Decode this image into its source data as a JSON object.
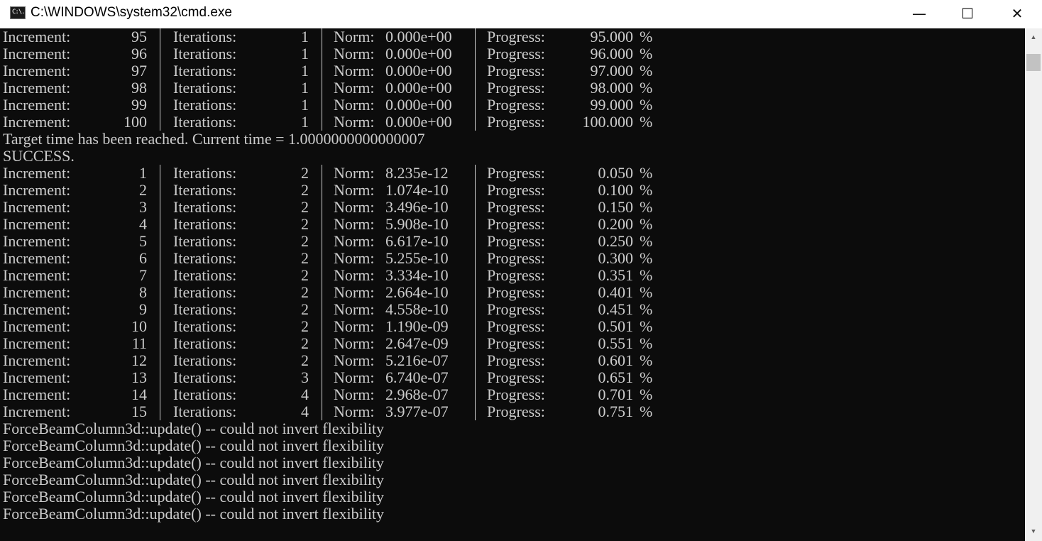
{
  "window": {
    "title": "C:\\WINDOWS\\system32\\cmd.exe",
    "icon_text": "C:\\.",
    "minimize": "—",
    "maximize": "☐",
    "close": "✕"
  },
  "labels": {
    "increment": "Increment:",
    "iterations": "Iterations:",
    "norm": "Norm:",
    "progress": "Progress:",
    "percent": "%"
  },
  "console": {
    "rows_a": [
      {
        "inc": "95",
        "iter": "1",
        "norm": "0.000e+00",
        "prog": "95.000"
      },
      {
        "inc": "96",
        "iter": "1",
        "norm": "0.000e+00",
        "prog": "96.000"
      },
      {
        "inc": "97",
        "iter": "1",
        "norm": "0.000e+00",
        "prog": "97.000"
      },
      {
        "inc": "98",
        "iter": "1",
        "norm": "0.000e+00",
        "prog": "98.000"
      },
      {
        "inc": "99",
        "iter": "1",
        "norm": "0.000e+00",
        "prog": "99.000"
      },
      {
        "inc": "100",
        "iter": "1",
        "norm": "0.000e+00",
        "prog": "100.000"
      }
    ],
    "target_msg": "Target time has been reached. Current time = 1.0000000000000007",
    "success_msg": "SUCCESS.",
    "rows_b": [
      {
        "inc": "1",
        "iter": "2",
        "norm": "8.235e-12",
        "prog": "0.050"
      },
      {
        "inc": "2",
        "iter": "2",
        "norm": "1.074e-10",
        "prog": "0.100"
      },
      {
        "inc": "3",
        "iter": "2",
        "norm": "3.496e-10",
        "prog": "0.150"
      },
      {
        "inc": "4",
        "iter": "2",
        "norm": "5.908e-10",
        "prog": "0.200"
      },
      {
        "inc": "5",
        "iter": "2",
        "norm": "6.617e-10",
        "prog": "0.250"
      },
      {
        "inc": "6",
        "iter": "2",
        "norm": "5.255e-10",
        "prog": "0.300"
      },
      {
        "inc": "7",
        "iter": "2",
        "norm": "3.334e-10",
        "prog": "0.351"
      },
      {
        "inc": "8",
        "iter": "2",
        "norm": "2.664e-10",
        "prog": "0.401"
      },
      {
        "inc": "9",
        "iter": "2",
        "norm": "4.558e-10",
        "prog": "0.451"
      },
      {
        "inc": "10",
        "iter": "2",
        "norm": "1.190e-09",
        "prog": "0.501"
      },
      {
        "inc": "11",
        "iter": "2",
        "norm": "2.647e-09",
        "prog": "0.551"
      },
      {
        "inc": "12",
        "iter": "2",
        "norm": "5.216e-07",
        "prog": "0.601"
      },
      {
        "inc": "13",
        "iter": "3",
        "norm": "6.740e-07",
        "prog": "0.651"
      },
      {
        "inc": "14",
        "iter": "4",
        "norm": "2.968e-07",
        "prog": "0.701"
      },
      {
        "inc": "15",
        "iter": "4",
        "norm": "3.977e-07",
        "prog": "0.751"
      }
    ],
    "error_lines": [
      "ForceBeamColumn3d::update() -- could not invert flexibility",
      "ForceBeamColumn3d::update() -- could not invert flexibility",
      "ForceBeamColumn3d::update() -- could not invert flexibility",
      "ForceBeamColumn3d::update() -- could not invert flexibility",
      "ForceBeamColumn3d::update() -- could not invert flexibility",
      "ForceBeamColumn3d::update() -- could not invert flexibility"
    ]
  },
  "scrollbar": {
    "up_arrow": "▲",
    "down_arrow": "▼"
  }
}
